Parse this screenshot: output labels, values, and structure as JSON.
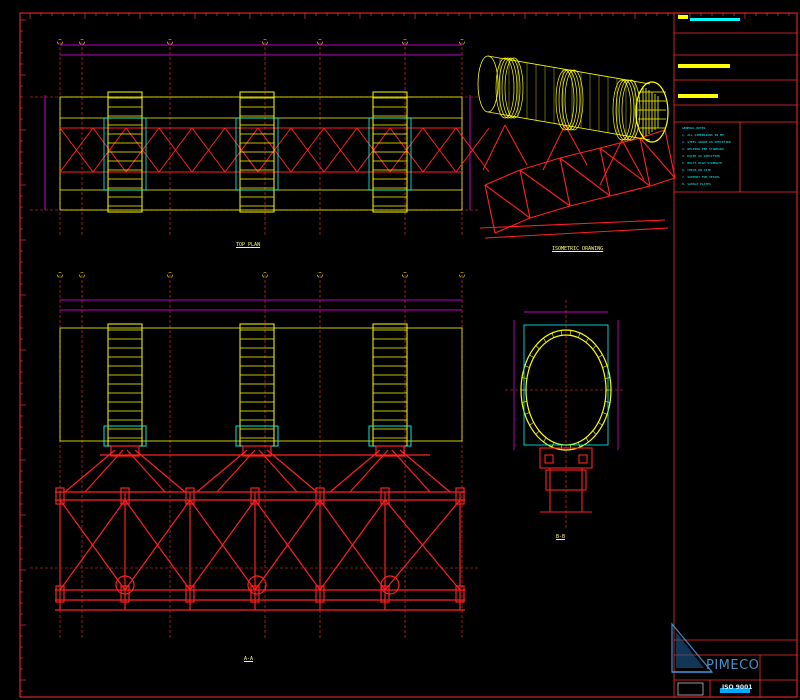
{
  "colors": {
    "background": "#000000",
    "border": "#ff2a2a",
    "structure": "#ff2020",
    "vessel": "#ffff00",
    "grid": "#ff3333",
    "dimension": "#ff00ff",
    "accent": "#00ffff",
    "logo": "#3f8fd0"
  },
  "views": {
    "top_plan_label": "TOP PLAN",
    "isometric_label": "ISOMETRIC DRAWING",
    "elevation_label": "A-A",
    "section_label": "B-B"
  },
  "title_block": {
    "notes": [
      "GENERAL NOTES",
      "1. ALL DIMENSIONS IN MM",
      "2. STEEL GRADE AS SPECIFIED",
      "3. WELDING PER STANDARD",
      "4. PAINT AS SPECIFIED",
      "5. BOLTS HIGH STRENGTH",
      "6. CHECK ON SITE",
      "7. SUPPORT FOR VESSEL",
      "8. SADDLE PLATES"
    ],
    "logo_text": "PIMECO",
    "logo_sub": "ISO 9001"
  },
  "icons": {
    "logo": "sail-logo-icon"
  }
}
